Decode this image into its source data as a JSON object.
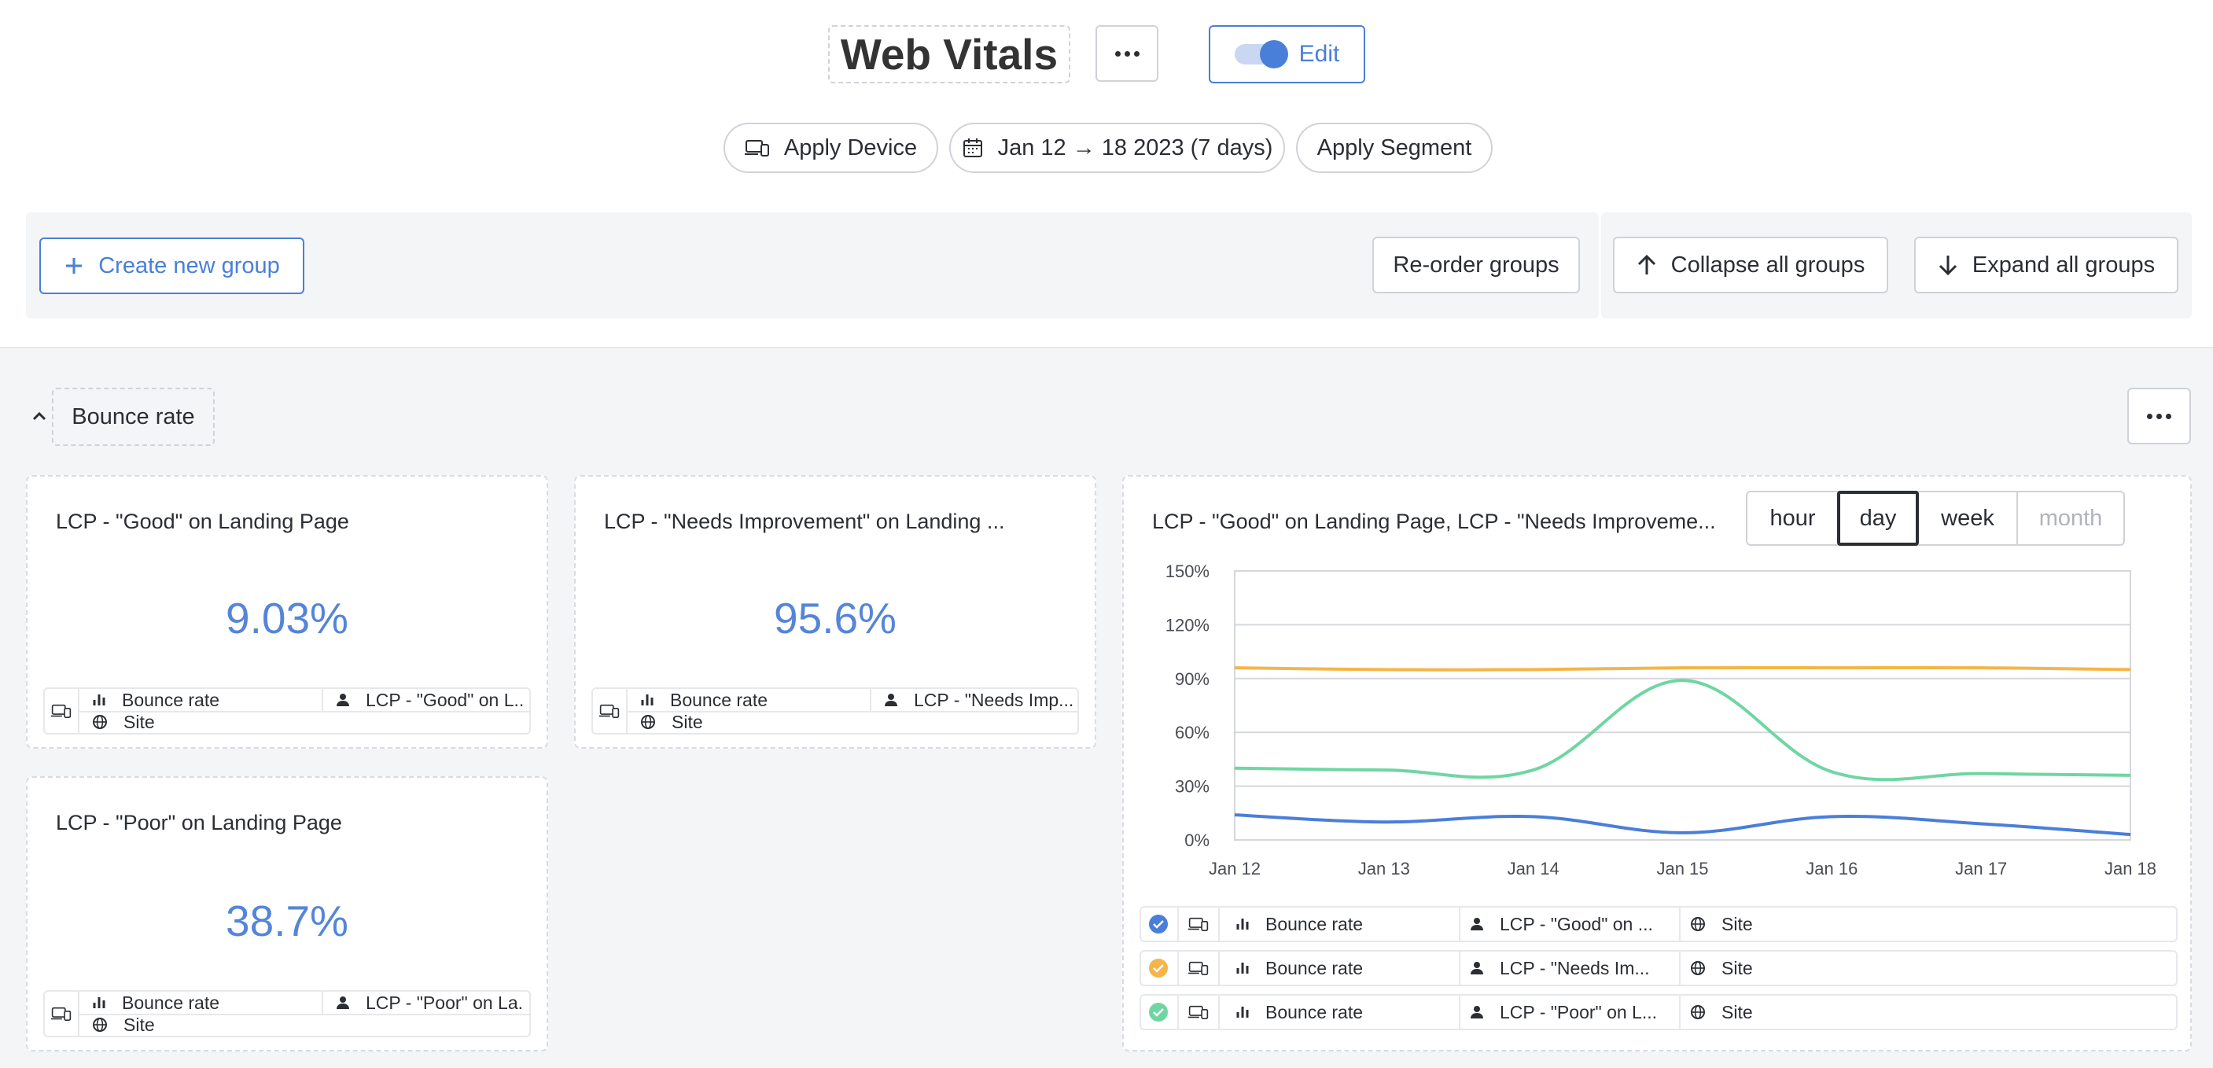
{
  "header": {
    "title": "Web Vitals",
    "edit_label": "Edit"
  },
  "filters": {
    "device": "Apply Device",
    "date_range": "Jan 12 → 18 2023 (7 days)",
    "segment": "Apply Segment"
  },
  "toolbar": {
    "create_group": "Create new group",
    "reorder": "Re-order groups",
    "collapse": "Collapse all groups",
    "expand": "Expand all groups"
  },
  "group": {
    "name": "Bounce rate"
  },
  "cards": [
    {
      "title": "LCP - \"Good\" on Landing Page",
      "value": "9.03%",
      "metric": "Bounce rate",
      "segment": "LCP - \"Good\" on L...",
      "site": "Site"
    },
    {
      "title": "LCP - \"Needs Improvement\" on Landing ...",
      "value": "95.6%",
      "metric": "Bounce rate",
      "segment": "LCP - \"Needs Imp...",
      "site": "Site"
    },
    {
      "title": "LCP - \"Poor\" on Landing Page",
      "value": "38.7%",
      "metric": "Bounce rate",
      "segment": "LCP - \"Poor\" on La...",
      "site": "Site"
    }
  ],
  "chart_card": {
    "title": "LCP - \"Good\" on Landing Page, LCP - \"Needs Improveme...",
    "granularity": [
      "hour",
      "day",
      "week",
      "month"
    ],
    "selected_granularity": "day",
    "legend": [
      {
        "metric": "Bounce rate",
        "segment": "LCP - \"Good\" on ...",
        "site": "Site",
        "color": "#4a7fd9"
      },
      {
        "metric": "Bounce rate",
        "segment": "LCP - \"Needs Im...",
        "site": "Site",
        "color": "#f5b54a"
      },
      {
        "metric": "Bounce rate",
        "segment": "LCP - \"Poor\" on L...",
        "site": "Site",
        "color": "#6fd6a2"
      }
    ]
  },
  "chart_data": {
    "type": "line",
    "x": [
      "Jan 12",
      "Jan 13",
      "Jan 14",
      "Jan 15",
      "Jan 16",
      "Jan 17",
      "Jan 18"
    ],
    "y_ticks": [
      "0%",
      "30%",
      "60%",
      "90%",
      "120%",
      "150%"
    ],
    "ylim": [
      0,
      150
    ],
    "grid": true,
    "legend_placement": "bottom",
    "series": [
      {
        "values": [
          14,
          10,
          13,
          4,
          13,
          9,
          3
        ],
        "color": "#4a7fd9"
      },
      {
        "values": [
          96,
          95,
          95,
          96,
          96,
          96,
          95
        ],
        "color": "#f5b54a"
      },
      {
        "values": [
          40,
          39,
          39,
          89,
          38,
          37,
          36
        ],
        "color": "#6fd6a2"
      }
    ]
  }
}
